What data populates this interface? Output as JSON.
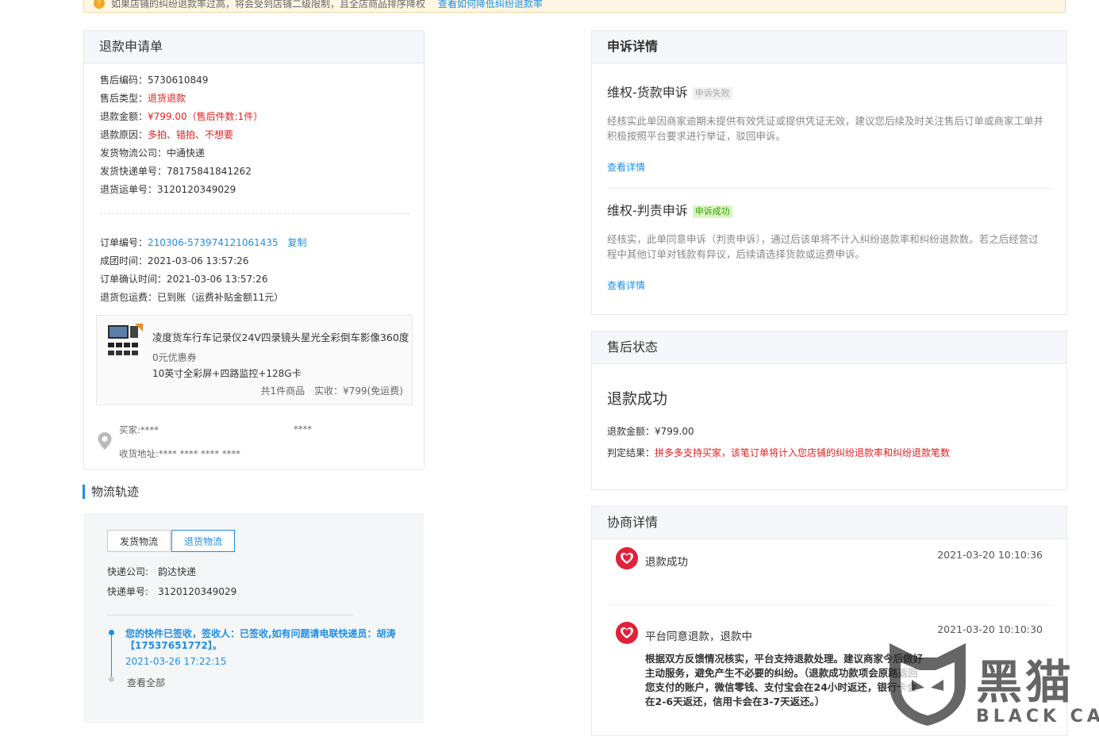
{
  "notice": {
    "text": "如果店铺的纠纷退款率过高，将会受到店铺二级限制，且全店商品排序降权",
    "link": "查看如何降低纠纷退款率"
  },
  "refund_form": {
    "title": "退款申请单",
    "fields": [
      {
        "label": "售后编码：",
        "value": "5730610849"
      },
      {
        "label": "售后类型：",
        "value": "退货退款"
      },
      {
        "label": "退款金额：",
        "value": "¥799.00（售后件数:1件）"
      },
      {
        "label": "退款原因：",
        "value": "多拍、错拍、不想要"
      },
      {
        "label": "发货物流公司：",
        "value": "中通快递"
      },
      {
        "label": "发货快递单号：",
        "value": "78175841841262"
      },
      {
        "label": "退货运单号：",
        "value": "3120120349029"
      }
    ],
    "order": {
      "number_label": "订单编号：",
      "number": "210306-573974121061435",
      "copy": "复制",
      "group_time": "成团时间：2021-03-06 13:57:26",
      "confirm_time": "订单确认时间：2021-03-06 13:57:26",
      "return_shipping": "退货包运费：已到账（运费补贴金额11元）"
    },
    "goods": {
      "title": "凌度货车行车记录仪24V四录镜头星光全彩倒车影像360度",
      "coupon": "0元优惠券",
      "spec": "10英寸全彩屏+四路监控+128G卡",
      "total": "共1件商品　实收：¥799(免运费)"
    },
    "buyer": {
      "name": "买家:****",
      "phone": "****",
      "address": "收货地址:**** **** **** ****"
    }
  },
  "logistics": {
    "title": "物流轨迹",
    "tabs": [
      "发货物流",
      "退货物流"
    ],
    "company": "快递公司:　韵达快递",
    "tracking": "快递单号:　3120120349029",
    "latest": "您的快件已签收，签收人：已签收,如有问题请电联快递员：胡涛【17537651772】。",
    "latest_time": "2021-03-26 17:22:15",
    "view_all": "查看全部"
  },
  "appeal": {
    "title": "申诉详情",
    "items": [
      {
        "title": "维权-货款申诉",
        "tag": "申诉失败",
        "desc": "经核实此单因商家逾期未提供有效凭证或提供凭证无效，建议您后续及时关注售后订单或商家工单并积极按照平台要求进行举证，驳回申诉。",
        "link": "查看详情"
      },
      {
        "title": "维权-判责申诉",
        "tag": "申诉成功",
        "desc": "经核实，此单同意申诉（判责申诉），通过后该单将不计入纠纷退款率和纠纷退款数。若之后经营过程中其他订单对钱款有异议，后续请选择货款或运费申诉。",
        "link": "查看详情"
      }
    ]
  },
  "after_sale_status": {
    "title": "售后状态",
    "status": "退款成功",
    "amount": "退款金额：¥799.00",
    "result_label": "判定结果：",
    "result": "拼多多支持买家，该笔订单将计入您店铺的纠纷退款率和纠纷退款笔数"
  },
  "negotiation": {
    "title": "协商详情",
    "items": [
      {
        "title": "退款成功",
        "time": "2021-03-20 10:10:36",
        "desc": ""
      },
      {
        "title": "平台同意退款，退款中",
        "time": "2021-03-20 10:10:30",
        "desc": "根据双方反馈情况核实，平台支持退款处理。建议商家今后做好主动服务，避免产生不必要的纠纷。（退款成功款项会原路返回您支付的账户，微信零钱、支付宝会在24小时返还，银行卡会在2-6天返还，信用卡会在3-7天返还。）"
      }
    ]
  },
  "watermark": {
    "cn": "黑猫",
    "en": "BLACK CAT"
  },
  "colors": {
    "accent": "#1f8ee6",
    "danger": "#e02020",
    "panel_header": "#f5f7fa"
  }
}
